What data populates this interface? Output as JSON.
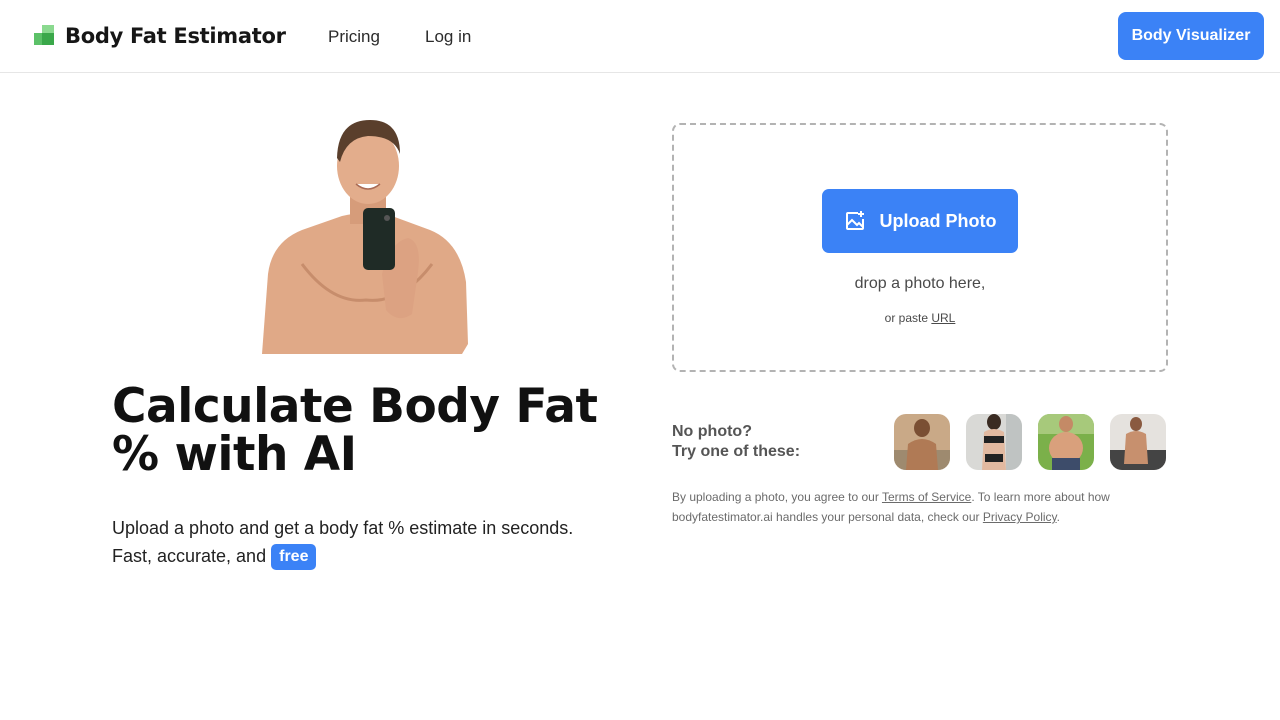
{
  "header": {
    "brand": "Body Fat Estimator",
    "nav": [
      {
        "label": "Pricing"
      },
      {
        "label": "Log in"
      }
    ],
    "cta_label": "Body Visualizer"
  },
  "hero": {
    "title_line1": "Calculate Body Fat",
    "title_line2": "% with AI",
    "subtitle_line1": "Upload a photo and get a body fat % estimate in seconds.",
    "subtitle_line2": "Fast, accurate, and",
    "badge": "free"
  },
  "upload": {
    "button_label": "Upload Photo",
    "drop_text": "drop a photo here,",
    "paste_prefix": "or paste",
    "paste_link": "URL"
  },
  "samples": {
    "prompt_line1": "No photo?",
    "prompt_line2": "Try one of these:",
    "count": 4
  },
  "legal": {
    "part1": "By uploading a photo, you agree to our",
    "tos_link": "Terms of Service",
    "part2": ". To learn more about how bodyfatestimator.ai handles your personal data, check our",
    "privacy_link": "Privacy Policy",
    "part3": "."
  },
  "colors": {
    "accent": "#3b82f6",
    "logo_green": "#5cc168"
  },
  "icons": {
    "logo": "logo-icon",
    "upload": "image-add-icon"
  }
}
